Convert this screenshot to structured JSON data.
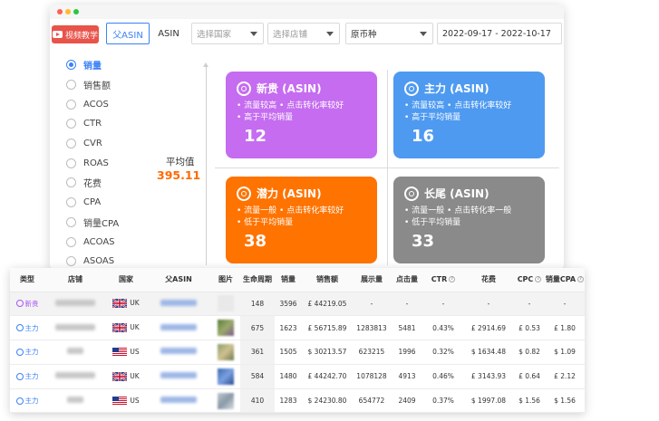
{
  "toolbar": {
    "video_button": "视频教学",
    "tab_parent_asin": "父ASIN",
    "tab_asin": "ASIN",
    "country_placeholder": "选择国家",
    "store_placeholder": "选择店铺",
    "currency": "原币种",
    "date_range": "2022-09-17 - 2022-10-17"
  },
  "metrics": [
    {
      "label": "销量",
      "selected": true
    },
    {
      "label": "销售额",
      "selected": false
    },
    {
      "label": "ACOS",
      "selected": false
    },
    {
      "label": "CTR",
      "selected": false
    },
    {
      "label": "CVR",
      "selected": false
    },
    {
      "label": "ROAS",
      "selected": false
    },
    {
      "label": "花费",
      "selected": false
    },
    {
      "label": "CPA",
      "selected": false
    },
    {
      "label": "销量CPA",
      "selected": false
    },
    {
      "label": "ACOAS",
      "selected": false
    },
    {
      "label": "ASOAS",
      "selected": false
    }
  ],
  "average": {
    "label": "平均值",
    "value": "395.11"
  },
  "quadrants": [
    {
      "title": "新贵 (ASIN)",
      "line1": "• 流量较高 • 点击转化率较好",
      "line2": "• 高于平均销量",
      "count": "12",
      "color": "#c56cf0",
      "icon": "award-icon"
    },
    {
      "title": "主力 (ASIN)",
      "line1": "• 流量较高 • 点击转化率较好",
      "line2": "• 高于平均销量",
      "count": "16",
      "color": "#4e9af1",
      "icon": "target-icon"
    },
    {
      "title": "潜力 (ASIN)",
      "line1": "• 流量一般 • 点击转化率较好",
      "line2": "• 低于平均销量",
      "count": "38",
      "color": "#ff7300",
      "icon": "gem-icon"
    },
    {
      "title": "长尾 (ASIN)",
      "line1": "• 流量一般 • 点击转化率一般",
      "line2": "• 低于平均销量",
      "count": "33",
      "color": "#8a8a8a",
      "icon": "bullseye-icon"
    }
  ],
  "table": {
    "headers": [
      "类型",
      "店铺",
      "国家",
      "父ASIN",
      "图片",
      "生命周期",
      "销量",
      "销售额",
      "展示量",
      "点击量",
      "CTR",
      "花费",
      "CPC",
      "销量CPA"
    ],
    "rows": [
      {
        "type": "新贵",
        "type_color": "#a855f7",
        "country": "UK",
        "flag": "uk",
        "cycle": "148",
        "sales": "3596",
        "revenue": "£ 44219.05",
        "impressions": "-",
        "clicks": "-",
        "ctr": "-",
        "spend": "-",
        "cpc": "-",
        "cpa": "-",
        "thumb": "t0"
      },
      {
        "type": "主力",
        "type_color": "#3b82f6",
        "country": "UK",
        "flag": "uk",
        "cycle": "675",
        "sales": "1623",
        "revenue": "£ 56715.89",
        "impressions": "1283813",
        "clicks": "5481",
        "ctr": "0.43%",
        "spend": "£ 2914.69",
        "cpc": "£ 0.53",
        "cpa": "£ 1.80",
        "thumb": "t1"
      },
      {
        "type": "主力",
        "type_color": "#3b82f6",
        "country": "US",
        "flag": "us",
        "cycle": "361",
        "sales": "1505",
        "revenue": "$ 30213.57",
        "impressions": "623215",
        "clicks": "1996",
        "ctr": "0.32%",
        "spend": "$ 1634.48",
        "cpc": "$ 0.82",
        "cpa": "$ 1.09",
        "thumb": "t2"
      },
      {
        "type": "主力",
        "type_color": "#3b82f6",
        "country": "UK",
        "flag": "uk",
        "cycle": "584",
        "sales": "1480",
        "revenue": "£ 44242.70",
        "impressions": "1078128",
        "clicks": "4913",
        "ctr": "0.46%",
        "spend": "£ 3143.93",
        "cpc": "£ 0.64",
        "cpa": "£ 2.12",
        "thumb": "t3"
      },
      {
        "type": "主力",
        "type_color": "#3b82f6",
        "country": "US",
        "flag": "us",
        "cycle": "410",
        "sales": "1283",
        "revenue": "$ 24230.80",
        "impressions": "654772",
        "clicks": "2409",
        "ctr": "0.37%",
        "spend": "$ 1997.08",
        "cpc": "$ 1.56",
        "cpa": "$ 1.56",
        "thumb": "t4"
      }
    ]
  }
}
